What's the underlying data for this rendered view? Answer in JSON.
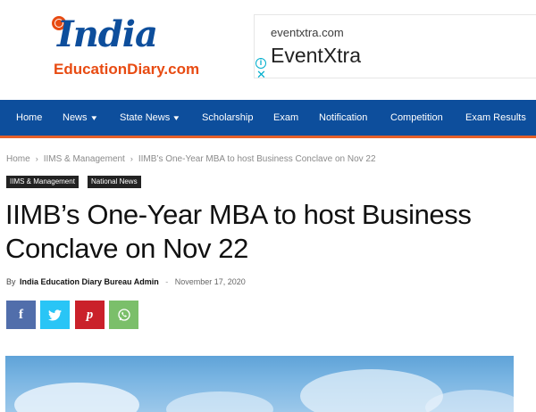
{
  "logo": {
    "line1": "India",
    "line2": "EducationDiary.com"
  },
  "ad": {
    "domain": "eventxtra.com",
    "brand": "EventXtra",
    "choices_icon": "ⓘ",
    "close_icon": "✕"
  },
  "nav": {
    "items": [
      {
        "label": "Home",
        "dropdown": false
      },
      {
        "label": "News",
        "dropdown": true
      },
      {
        "label": "State News",
        "dropdown": true
      },
      {
        "label": "Scholarship",
        "dropdown": false
      },
      {
        "label": "Exam",
        "dropdown": false
      },
      {
        "label": "Notification",
        "dropdown": false
      },
      {
        "label": "Competition",
        "dropdown": false
      },
      {
        "label": "Exam Results",
        "dropdown": false
      }
    ],
    "chevron": "⌄"
  },
  "breadcrumb": {
    "items": [
      "Home",
      "IIMS & Management",
      "IIMB’s One-Year MBA to host Business Conclave on Nov 22"
    ],
    "separator": "›"
  },
  "tags": [
    "IIMS & Management",
    "National News"
  ],
  "article": {
    "title": "IIMB’s One-Year MBA to host Business Conclave on Nov 22",
    "by": "By",
    "author": "India Education Diary Bureau Admin",
    "dash": "-",
    "date": "November 17, 2020"
  },
  "share": [
    {
      "icon": "facebook-icon",
      "glyph": "f",
      "color": "#516eab"
    },
    {
      "icon": "twitter-icon",
      "glyph": "🐦",
      "color": "#29c5f6"
    },
    {
      "icon": "pinterest-icon",
      "glyph": "p",
      "color": "#ca212a"
    },
    {
      "icon": "whatsapp-icon",
      "glyph": "✆",
      "color": "#7bbf6a"
    }
  ],
  "colors": {
    "nav_bg": "#0d4e9c",
    "nav_border": "#e4602a",
    "logo_blue": "#0d4e9c",
    "logo_orange": "#e84b12"
  }
}
